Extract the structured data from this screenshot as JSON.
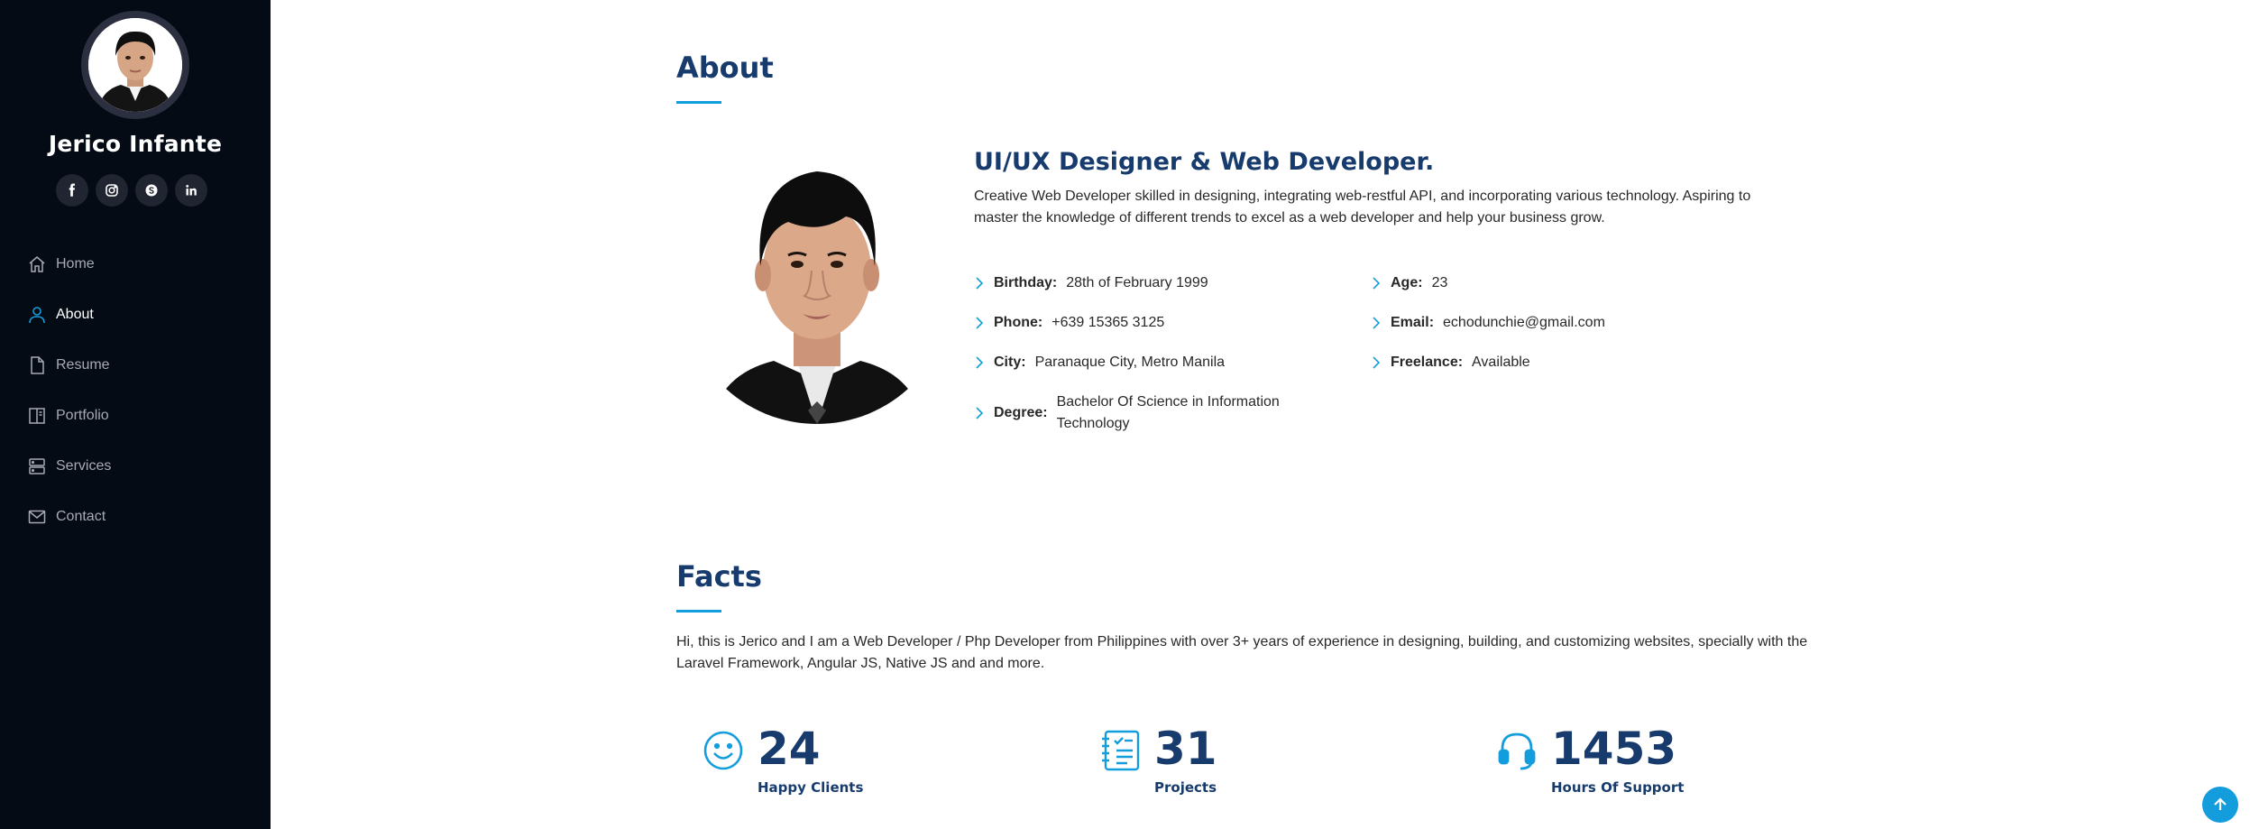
{
  "profile": {
    "name": "Jerico Infante"
  },
  "social": [
    {
      "icon": "facebook-icon",
      "glyph": "f"
    },
    {
      "icon": "instagram-icon",
      "glyph": ""
    },
    {
      "icon": "skype-icon",
      "glyph": ""
    },
    {
      "icon": "linkedin-icon",
      "glyph": "in"
    }
  ],
  "nav": {
    "items": [
      {
        "label": "Home",
        "icon": "home-icon",
        "active": false
      },
      {
        "label": "About",
        "icon": "person-icon",
        "active": true
      },
      {
        "label": "Resume",
        "icon": "file-icon",
        "active": false
      },
      {
        "label": "Portfolio",
        "icon": "book-icon",
        "active": false
      },
      {
        "label": "Services",
        "icon": "server-icon",
        "active": false
      },
      {
        "label": "Contact",
        "icon": "envelope-icon",
        "active": false
      }
    ]
  },
  "about": {
    "title": "About",
    "heading": "UI/UX Designer & Web Developer.",
    "description": "Creative Web Developer skilled in designing, integrating web-restful API, and incorporating various technology. Aspiring to master the knowledge of different trends to excel as a web developer and help your business grow.",
    "info": {
      "birthday": {
        "label": "Birthday:",
        "value": "28th of February 1999"
      },
      "phone": {
        "label": "Phone:",
        "value": "+639 15365 3125"
      },
      "city": {
        "label": "City:",
        "value": "Paranaque City, Metro Manila"
      },
      "degree": {
        "label": "Degree:",
        "value": "Bachelor Of Science in Information Technology"
      },
      "age": {
        "label": "Age:",
        "value": "23"
      },
      "email": {
        "label": "Email:",
        "value": "echodunchie@gmail.com"
      },
      "freelance": {
        "label": "Freelance:",
        "value": "Available"
      }
    }
  },
  "facts": {
    "title": "Facts",
    "text": "Hi, this is Jerico and I am a Web Developer / Php Developer from Philippines with over 3+ years of experience in designing, building, and customizing websites, specially with the Laravel Framework, Angular JS, Native JS and and more.",
    "counters": [
      {
        "value": "24",
        "label": "Happy Clients",
        "icon": "smile-icon"
      },
      {
        "value": "31",
        "label": "Projects",
        "icon": "journal-icon"
      },
      {
        "value": "1453",
        "label": "Hours Of Support",
        "icon": "headset-icon"
      }
    ]
  },
  "colors": {
    "sidebar": "#040b14",
    "accent": "#149ddd",
    "heading": "#173b6c"
  }
}
